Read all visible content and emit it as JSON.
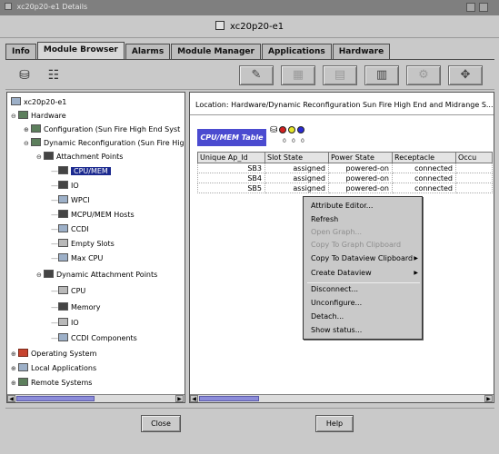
{
  "window": {
    "title": "xc20p20-e1 Details"
  },
  "header": {
    "title": "xc20p20-e1"
  },
  "tabs": [
    "Info",
    "Module Browser",
    "Alarms",
    "Module Manager",
    "Applications",
    "Hardware"
  ],
  "active_tab": "Module Browser",
  "toolbar": {
    "left_icons": [
      "module-browser-icon",
      "hierarchy-icon"
    ],
    "right_buttons": [
      "edit-icon",
      "grid-icon",
      "grid-disabled-icon",
      "table-view-icon",
      "gear-icon",
      "target-icon"
    ]
  },
  "tree": {
    "items": [
      {
        "label": "xc20p20-e1",
        "depth": 0,
        "icon": "host-icon"
      },
      {
        "label": "Hardware",
        "depth": 1,
        "icon": "hardware-icon"
      },
      {
        "label": "Configuration (Sun Fire High End Syst",
        "depth": 2,
        "icon": "config-icon"
      },
      {
        "label": "Dynamic Reconfiguration (Sun Fire High",
        "depth": 2,
        "icon": "dr-icon"
      },
      {
        "label": "Attachment Points",
        "depth": 3,
        "icon": "attachment-icon"
      },
      {
        "label": "CPU/MEM",
        "depth": 4,
        "icon": "cpu-mem-icon",
        "selected": true
      },
      {
        "label": "IO",
        "depth": 4,
        "icon": "io-icon"
      },
      {
        "label": "WPCI",
        "depth": 4,
        "icon": "wpci-icon"
      },
      {
        "label": "MCPU/MEM Hosts",
        "depth": 4,
        "icon": "mcpu-icon"
      },
      {
        "label": "CCDI",
        "depth": 4,
        "icon": "ccdi-icon"
      },
      {
        "label": "Empty Slots",
        "depth": 4,
        "icon": "slots-icon"
      },
      {
        "label": "Max CPU",
        "depth": 4,
        "icon": "maxcpu-icon"
      },
      {
        "label": "Dynamic Attachment Points",
        "depth": 3,
        "icon": "dynamic-attachment-icon"
      },
      {
        "label": "CPU",
        "depth": 4,
        "icon": "cpu-icon"
      },
      {
        "label": "Memory",
        "depth": 4,
        "icon": "memory-icon"
      },
      {
        "label": "IO",
        "depth": 4,
        "icon": "io-icon"
      },
      {
        "label": "CCDI Components",
        "depth": 4,
        "icon": "ccdi-icon"
      },
      {
        "label": "Operating System",
        "depth": 0,
        "icon": "os-icon"
      },
      {
        "label": "Local Applications",
        "depth": 0,
        "icon": "apps-icon"
      },
      {
        "label": "Remote Systems",
        "depth": 0,
        "icon": "remote-icon"
      }
    ]
  },
  "location": {
    "label": "Location:",
    "path": "Hardware/Dynamic Reconfiguration Sun Fire High End and Midrange S..."
  },
  "table": {
    "title": "CPU/MEM Table",
    "legend_counts": [
      "0",
      "0",
      "0"
    ],
    "columns": [
      "Unique Ap_Id",
      "Slot State",
      "Power State",
      "Receptacle",
      "Occu"
    ],
    "rows": [
      [
        "SB3",
        "assigned",
        "powered-on",
        "connected",
        ""
      ],
      [
        "SB4",
        "assigned",
        "powered-on",
        "connected",
        ""
      ],
      [
        "SB5",
        "assigned",
        "powered-on",
        "connected",
        ""
      ]
    ]
  },
  "context_menu": {
    "items": [
      {
        "label": "Attribute Editor...",
        "enabled": true
      },
      {
        "label": "Refresh",
        "enabled": true
      },
      {
        "label": "Open Graph...",
        "enabled": false
      },
      {
        "label": "Copy To Graph Clipboard",
        "enabled": false
      },
      {
        "label": "Copy To Dataview Clipboard",
        "enabled": true,
        "submenu": true
      },
      {
        "label": "Create Dataview",
        "enabled": true,
        "submenu": true
      },
      {
        "label": "Disconnect...",
        "enabled": true
      },
      {
        "label": "Unconfigure...",
        "enabled": true
      },
      {
        "label": "Detach...",
        "enabled": true
      },
      {
        "label": "Show status...",
        "enabled": true
      }
    ]
  },
  "buttons": {
    "close": "Close",
    "help": "Help"
  }
}
